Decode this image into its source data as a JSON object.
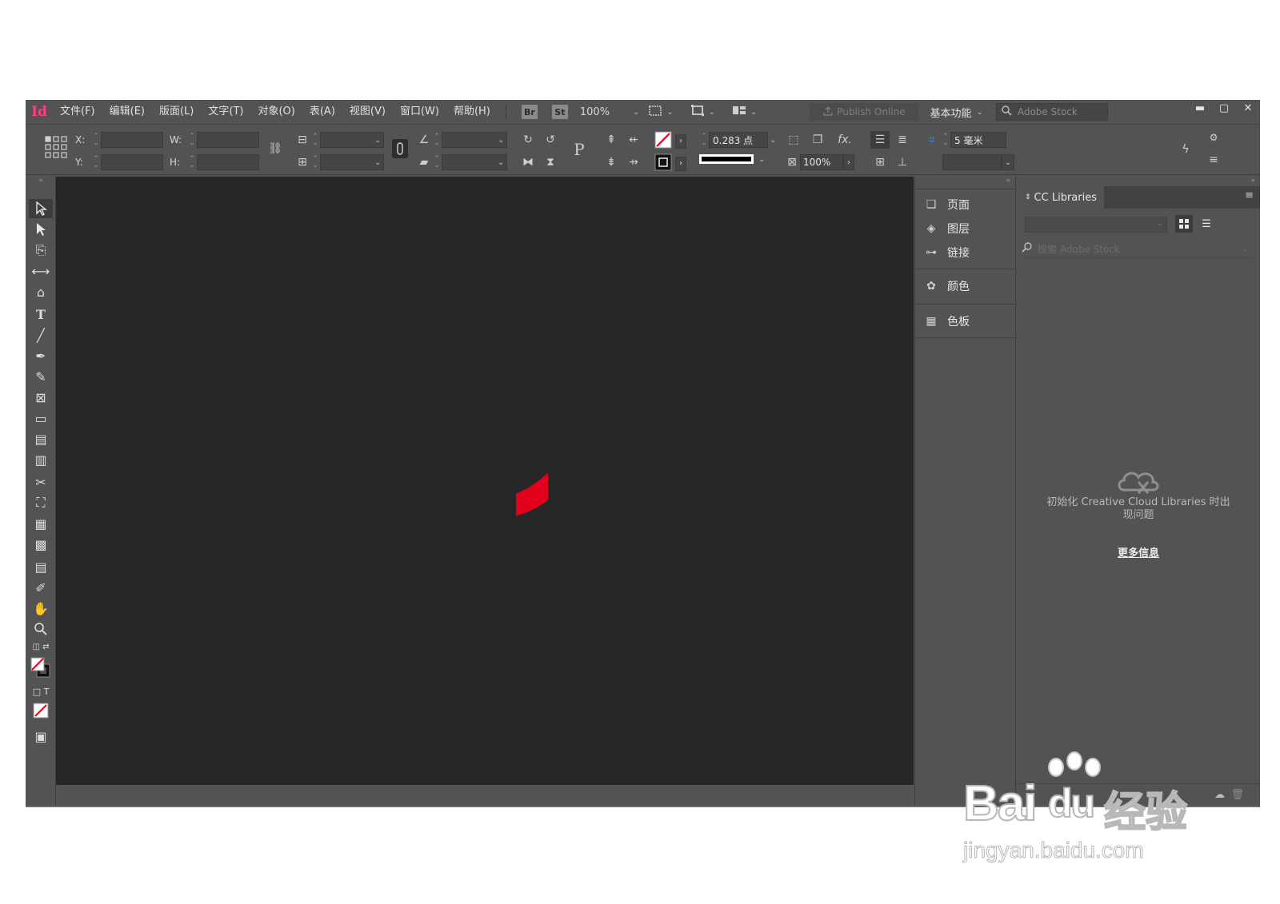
{
  "app": {
    "logo": "Id",
    "accent": "#ff3d8b"
  },
  "menubar": {
    "items": [
      "文件(F)",
      "编辑(E)",
      "版面(L)",
      "文字(T)",
      "对象(O)",
      "表(A)",
      "视图(V)",
      "窗口(W)",
      "帮助(H)"
    ],
    "bridge_label": "Br",
    "stock_label": "St",
    "zoom": "100%",
    "publish_online": "Publish Online",
    "workspace": "基本功能",
    "search_placeholder": "Adobe Stock"
  },
  "controlbar": {
    "x_label": "X:",
    "y_label": "Y:",
    "w_label": "W:",
    "h_label": "H:",
    "stroke_weight": "0.283 点",
    "opacity": "100%",
    "spacing": "5 毫米"
  },
  "canvas": {
    "content_color": "#e0001b"
  },
  "dock": {
    "items": [
      {
        "label": "页面",
        "icon": "pages-icon"
      },
      {
        "label": "图层",
        "icon": "layers-icon"
      },
      {
        "label": "链接",
        "icon": "links-icon"
      },
      {
        "label": "颜色",
        "icon": "color-icon"
      },
      {
        "label": "色板",
        "icon": "swatches-icon"
      }
    ]
  },
  "libraries": {
    "tab_title": "CC Libraries",
    "search_placeholder": "搜索 Adobe Stock",
    "error_line1": "初始化 Creative Cloud Libraries 时出",
    "error_line2": "现问题",
    "more_info": "更多信息"
  },
  "watermark": {
    "brand_line": "Bai",
    "brand_du": "du",
    "brand_cn": "经验",
    "domain": "jingyan.baidu.com"
  }
}
